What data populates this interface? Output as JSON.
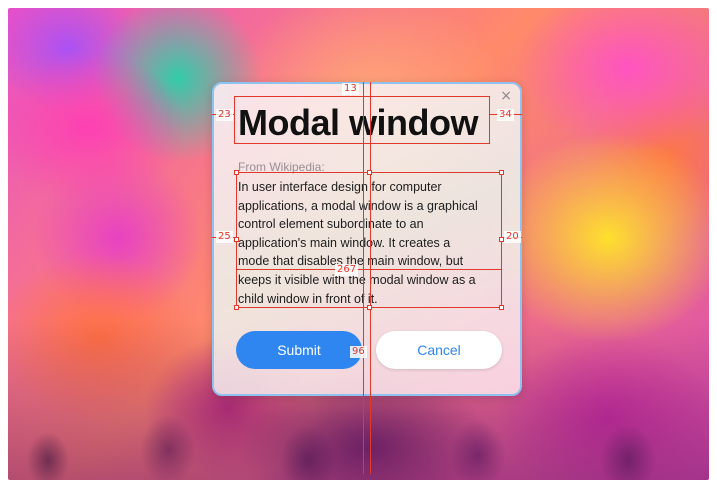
{
  "modal": {
    "close_icon": "×",
    "title": "Modal window",
    "source": "From Wikipedia:",
    "body_lines": [
      "In user interface design for computer",
      "applications, a modal window is a graphical",
      "control element subordinate to an",
      "application's main window. It creates a",
      "mode that disables the main window, but",
      "keeps it visible with the modal window as a",
      "child window in front of it."
    ],
    "submit_label": "Submit",
    "cancel_label": "Cancel"
  },
  "spec": {
    "top_spacing": "13",
    "title_left": "23",
    "title_right": "34",
    "text_left": "25",
    "text_right": "20",
    "text_width": "267",
    "button_gap": "96"
  },
  "colors": {
    "accent": "#2f86f0",
    "spec_red": "#e0392b",
    "modal_border": "#8ec3f0"
  }
}
